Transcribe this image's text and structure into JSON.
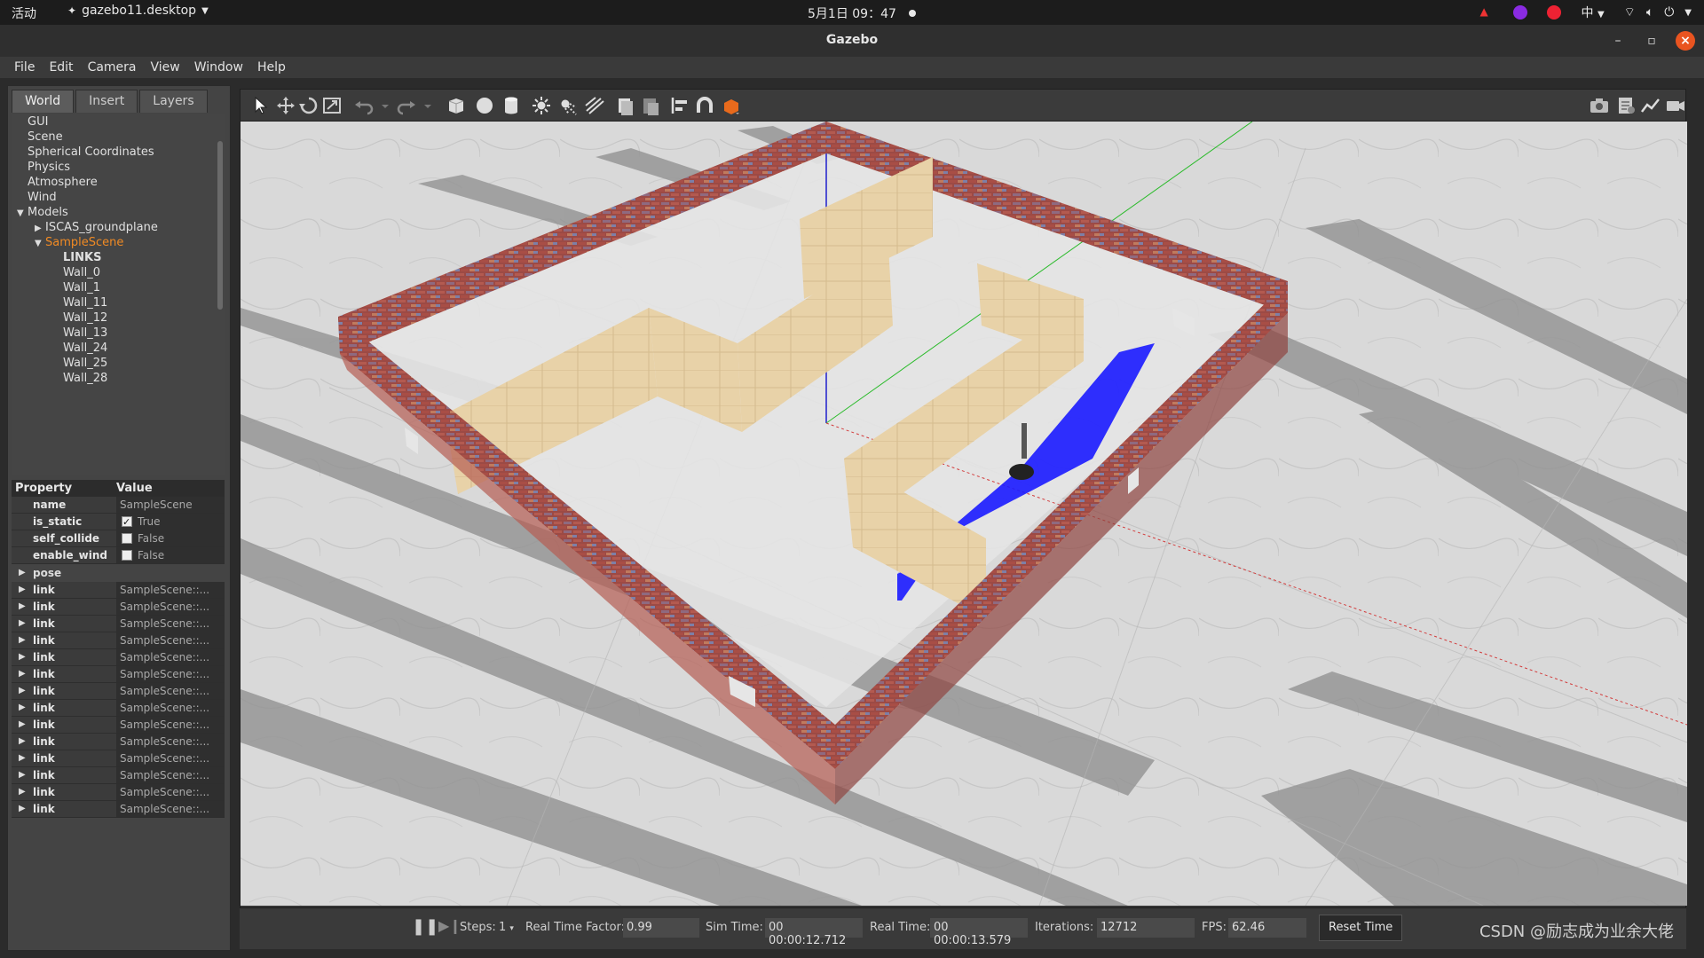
{
  "topbar": {
    "activities": "活动",
    "app_menu": "gazebo11.desktop",
    "clock": "5月1日 09：47",
    "input_method": "中"
  },
  "window": {
    "title": "Gazebo"
  },
  "menu": [
    "File",
    "Edit",
    "Camera",
    "View",
    "Window",
    "Help"
  ],
  "left_tabs": [
    "World",
    "Insert",
    "Layers"
  ],
  "tree": [
    {
      "label": "GUI",
      "indent": 0,
      "caret": ""
    },
    {
      "label": "Scene",
      "indent": 0,
      "caret": ""
    },
    {
      "label": "Spherical Coordinates",
      "indent": 0,
      "caret": ""
    },
    {
      "label": "Physics",
      "indent": 0,
      "caret": ""
    },
    {
      "label": "Atmosphere",
      "indent": 0,
      "caret": ""
    },
    {
      "label": "Wind",
      "indent": 0,
      "caret": ""
    },
    {
      "label": "Models",
      "indent": 0,
      "caret": "open"
    },
    {
      "label": "ISCAS_groundplane",
      "indent": 1,
      "caret": "closed"
    },
    {
      "label": "SampleScene",
      "indent": 1,
      "caret": "open",
      "selected": true
    },
    {
      "label": "LINKS",
      "indent": 2,
      "caret": "",
      "bold": true
    },
    {
      "label": "Wall_0",
      "indent": 2,
      "caret": ""
    },
    {
      "label": "Wall_1",
      "indent": 2,
      "caret": ""
    },
    {
      "label": "Wall_11",
      "indent": 2,
      "caret": ""
    },
    {
      "label": "Wall_12",
      "indent": 2,
      "caret": ""
    },
    {
      "label": "Wall_13",
      "indent": 2,
      "caret": ""
    },
    {
      "label": "Wall_24",
      "indent": 2,
      "caret": ""
    },
    {
      "label": "Wall_25",
      "indent": 2,
      "caret": ""
    },
    {
      "label": "Wall_28",
      "indent": 2,
      "caret": ""
    }
  ],
  "props": {
    "header": {
      "property": "Property",
      "value": "Value"
    },
    "rows": [
      {
        "name": "name",
        "value": "SampleScene",
        "checkbox": null
      },
      {
        "name": "is_static",
        "value": "True",
        "checkbox": true
      },
      {
        "name": "self_collide",
        "value": "False",
        "checkbox": false
      },
      {
        "name": "enable_wind",
        "value": "False",
        "checkbox": false
      }
    ],
    "pose_label": "pose",
    "links": [
      {
        "name": "link",
        "value": "SampleScene::..."
      },
      {
        "name": "link",
        "value": "SampleScene::..."
      },
      {
        "name": "link",
        "value": "SampleScene::..."
      },
      {
        "name": "link",
        "value": "SampleScene::..."
      },
      {
        "name": "link",
        "value": "SampleScene::..."
      },
      {
        "name": "link",
        "value": "SampleScene::..."
      },
      {
        "name": "link",
        "value": "SampleScene::..."
      },
      {
        "name": "link",
        "value": "SampleScene::..."
      },
      {
        "name": "link",
        "value": "SampleScene::..."
      },
      {
        "name": "link",
        "value": "SampleScene::..."
      },
      {
        "name": "link",
        "value": "SampleScene::..."
      },
      {
        "name": "link",
        "value": "SampleScene::..."
      },
      {
        "name": "link",
        "value": "SampleScene::..."
      },
      {
        "name": "link",
        "value": "SampleScene::..."
      }
    ]
  },
  "bottom": {
    "steps_label": "Steps:",
    "steps_value": "1",
    "rtf_label": "Real Time Factor:",
    "rtf_value": "0.99",
    "sim_label": "Sim Time:",
    "sim_value": "00 00:00:12.712",
    "real_label": "Real Time:",
    "real_value": "00 00:00:13.579",
    "iter_label": "Iterations:",
    "iter_value": "12712",
    "fps_label": "FPS:",
    "fps_value": "62.46",
    "reset_label": "Reset Time"
  },
  "watermark": "CSDN @励志成为业余大佬",
  "colors": {
    "accent_selected": "#f08a24",
    "laser": "#1a1aff",
    "brick": "#9c4a45",
    "wood": "#e8d2a8"
  },
  "toolbar_icons": [
    "select-arrow-icon",
    "translate-icon",
    "rotate-icon",
    "scale-icon",
    "undo-icon",
    "redo-icon",
    "box-shape-icon",
    "sphere-shape-icon",
    "cylinder-shape-icon",
    "point-light-icon",
    "spot-light-icon",
    "directional-light-icon",
    "copy-icon",
    "paste-icon",
    "align-icon",
    "snap-icon",
    "view-angle-icon",
    "screenshot-icon",
    "log-icon",
    "plot-icon",
    "video-record-icon"
  ]
}
